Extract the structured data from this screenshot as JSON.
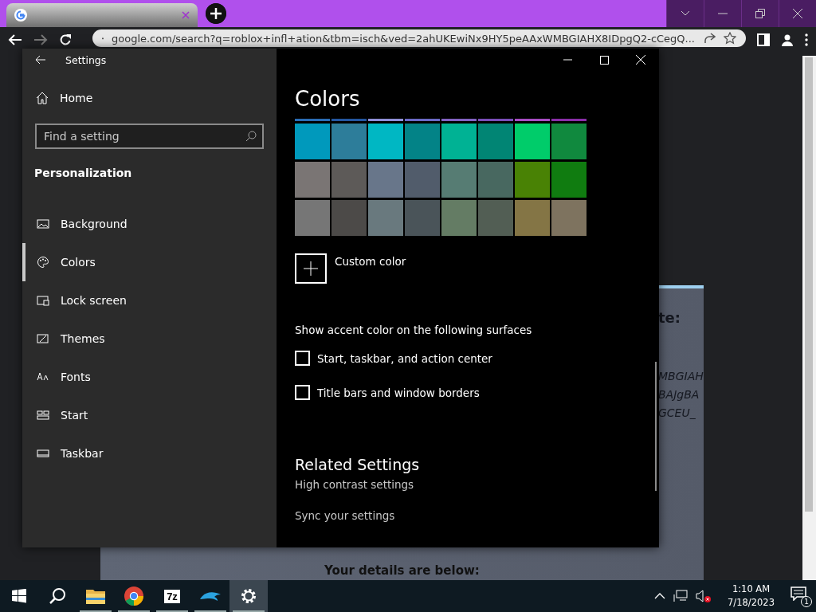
{
  "browser": {
    "url": "google.com/search?q=roblox+infl+ation&tbm=isch&ved=2ahUKEwiNx9HY5peAAxWMBGIAHX8IDpgQ2-cCegQ...",
    "page": {
      "card_lines": [
        "te:",
        "MBGIAH",
        "BAJgBA",
        "GCEU_"
      ],
      "footer_heading": "Your details are below:"
    }
  },
  "settings": {
    "window_title": "Settings",
    "home": "Home",
    "search": {
      "placeholder": "Find a setting"
    },
    "section": "Personalization",
    "nav": [
      {
        "label": "Background",
        "selected": false
      },
      {
        "label": "Colors",
        "selected": true
      },
      {
        "label": "Lock screen",
        "selected": false
      },
      {
        "label": "Themes",
        "selected": false
      },
      {
        "label": "Fonts",
        "selected": false
      },
      {
        "label": "Start",
        "selected": false
      },
      {
        "label": "Taskbar",
        "selected": false
      }
    ],
    "heading": "Colors",
    "swatch_rows": [
      {
        "kind": "strip",
        "swatches": [
          {
            "color": "#2a6db5"
          },
          {
            "color": "#2456a0"
          },
          {
            "color": "#8f8fd8"
          },
          {
            "color": "#6b69c6"
          },
          {
            "color": "#8262c2"
          },
          {
            "color": "#7a4db8"
          },
          {
            "color": "#a84cc4"
          },
          {
            "color": "#8a2ea8"
          }
        ]
      },
      {
        "kind": "full",
        "swatches": [
          {
            "color": "#0099bc"
          },
          {
            "color": "#2d7d9a"
          },
          {
            "color": "#00b7c3"
          },
          {
            "color": "#038387"
          },
          {
            "color": "#00b294"
          },
          {
            "color": "#018574"
          },
          {
            "color": "#00cc6a"
          },
          {
            "color": "#10893e"
          }
        ]
      },
      {
        "kind": "full",
        "swatches": [
          {
            "color": "#7a7574"
          },
          {
            "color": "#5d5a58"
          },
          {
            "color": "#68768a"
          },
          {
            "color": "#515c6b"
          },
          {
            "color": "#567c73"
          },
          {
            "color": "#486860"
          },
          {
            "color": "#498205"
          },
          {
            "color": "#107c10"
          }
        ]
      },
      {
        "kind": "full",
        "swatches": [
          {
            "color": "#767676"
          },
          {
            "color": "#4c4a48"
          },
          {
            "color": "#69797e"
          },
          {
            "color": "#4a5459"
          },
          {
            "color": "#647c64"
          },
          {
            "color": "#525e54"
          },
          {
            "color": "#847545"
          },
          {
            "color": "#7e735f"
          }
        ]
      }
    ],
    "custom_color": "Custom color",
    "surfaces_label": "Show accent color on the following surfaces",
    "surfaces": [
      {
        "label": "Start, taskbar, and action center",
        "checked": false
      },
      {
        "label": "Title bars and window borders",
        "checked": false
      }
    ],
    "related_heading": "Related Settings",
    "related_links": [
      "High contrast settings",
      "Sync your settings"
    ]
  },
  "taskbar": {
    "apps": [
      {
        "kind": "start",
        "active": false,
        "running": false
      },
      {
        "kind": "search",
        "active": false,
        "running": false
      },
      {
        "kind": "folder",
        "active": false,
        "running": true
      },
      {
        "kind": "chrome",
        "active": false,
        "running": true
      },
      {
        "kind": "zip",
        "label": "7z",
        "active": false,
        "running": true
      },
      {
        "kind": "dolphin",
        "active": false,
        "running": true
      },
      {
        "kind": "gear",
        "active": true,
        "running": true
      }
    ],
    "time": "1:10 AM",
    "date": "7/18/2023",
    "notifications": "1"
  }
}
